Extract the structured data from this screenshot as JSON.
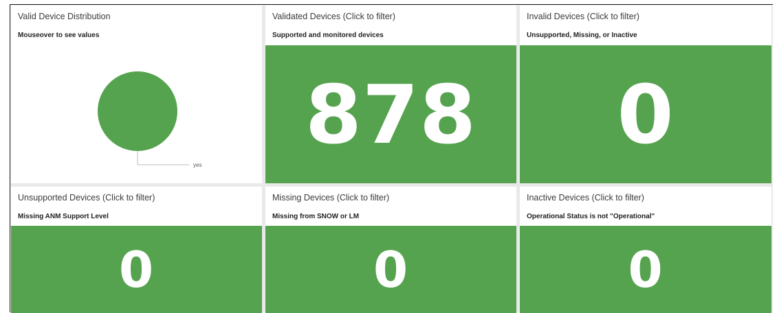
{
  "colors": {
    "tile_green": "#56a34f",
    "pie_green": "#56a34f",
    "panel_bg": "#ffffff",
    "gutter": "#e9e9e9"
  },
  "panels": [
    {
      "title": "Valid Device Distribution",
      "subtitle": "Mouseover to see values",
      "chart_data": {
        "type": "pie",
        "categories": [
          "yes"
        ],
        "values": [
          878
        ],
        "legend": "bottom-right"
      }
    },
    {
      "title": "Validated Devices (Click to filter)",
      "subtitle": "Supported and monitored devices",
      "value": "878"
    },
    {
      "title": "Invalid Devices (Click to filter)",
      "subtitle": "Unsupported, Missing, or Inactive",
      "value": "0"
    },
    {
      "title": "Unsupported Devices (Click to filter)",
      "subtitle": "Missing ANM Support Level",
      "value": "0"
    },
    {
      "title": "Missing Devices (Click to filter)",
      "subtitle": "Missing from SNOW or LM",
      "value": "0"
    },
    {
      "title": "Inactive Devices (Click to filter)",
      "subtitle": "Operational Status is not \"Operational\"",
      "value": "0"
    }
  ]
}
